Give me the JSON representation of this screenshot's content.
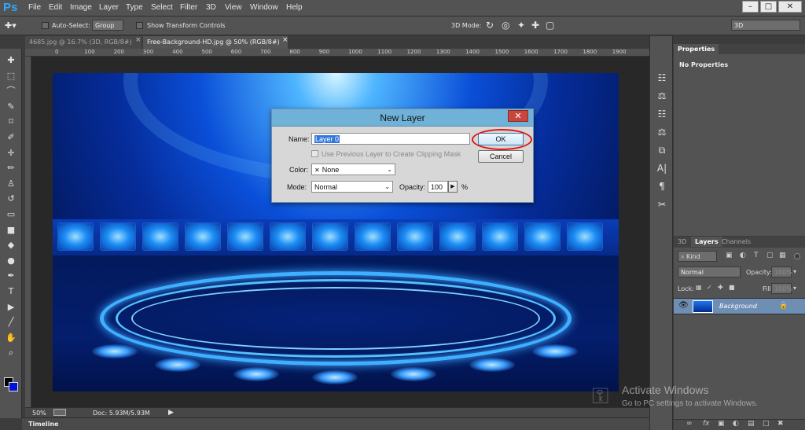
{
  "app": {
    "logo": "Ps"
  },
  "menu": [
    "File",
    "Edit",
    "Image",
    "Layer",
    "Type",
    "Select",
    "Filter",
    "3D",
    "View",
    "Window",
    "Help"
  ],
  "window_controls": {
    "minimize": "–",
    "restore": "□",
    "close": "✕"
  },
  "options_bar": {
    "auto_select_label": "Auto-Select:",
    "auto_select_value": "Group",
    "show_transform_label": "Show Transform Controls",
    "mode_label": "3D Mode:",
    "workspace_value": "3D"
  },
  "document_tabs": [
    {
      "label": "4685.jpg @ 16.7% (3D, RGB/8#)",
      "close": "×",
      "active": false
    },
    {
      "label": "Free-Background-HD.jpg @ 50% (RGB/8#)",
      "close": "×",
      "active": true
    }
  ],
  "ruler_numbers": [
    "0",
    "100",
    "200",
    "300",
    "400",
    "500",
    "600",
    "700",
    "800",
    "900",
    "1000",
    "1100",
    "1200",
    "1300",
    "1400",
    "1500",
    "1600",
    "1700",
    "1800",
    "1900"
  ],
  "tools": [
    {
      "icon": "move-tool-icon",
      "glyph": "✚"
    },
    {
      "icon": "marquee-tool-icon",
      "glyph": "⬚"
    },
    {
      "icon": "lasso-tool-icon",
      "glyph": "⌒"
    },
    {
      "icon": "quick-select-tool-icon",
      "glyph": "✎"
    },
    {
      "icon": "crop-tool-icon",
      "glyph": "⌑"
    },
    {
      "icon": "eyedropper-tool-icon",
      "glyph": "✐"
    },
    {
      "icon": "healing-brush-tool-icon",
      "glyph": "✛"
    },
    {
      "icon": "brush-tool-icon",
      "glyph": "✏"
    },
    {
      "icon": "clone-stamp-tool-icon",
      "glyph": "♙"
    },
    {
      "icon": "history-brush-tool-icon",
      "glyph": "↺"
    },
    {
      "icon": "eraser-tool-icon",
      "glyph": "▭"
    },
    {
      "icon": "gradient-tool-icon",
      "glyph": "■"
    },
    {
      "icon": "blur-tool-icon",
      "glyph": "◆"
    },
    {
      "icon": "dodge-tool-icon",
      "glyph": "●"
    },
    {
      "icon": "pen-tool-icon",
      "glyph": "✒"
    },
    {
      "icon": "type-tool-icon",
      "glyph": "T"
    },
    {
      "icon": "path-select-tool-icon",
      "glyph": "▶"
    },
    {
      "icon": "line-tool-icon",
      "glyph": "╱"
    },
    {
      "icon": "hand-tool-icon",
      "glyph": "✋"
    },
    {
      "icon": "zoom-tool-icon",
      "glyph": "⌕"
    }
  ],
  "status": {
    "zoom": "50%",
    "doc": "Doc: 5.93M/5.93M"
  },
  "timeline": {
    "label": "Timeline"
  },
  "side_icons": [
    "☷",
    "⚖",
    "☷",
    "⚖",
    "⧉",
    "A|",
    "¶",
    "✂"
  ],
  "properties": {
    "tab": "Properties",
    "content": "No Properties"
  },
  "layers_panel": {
    "tabs": [
      "3D",
      "Layers",
      "Channels"
    ],
    "filter_label": "Kind",
    "blend_mode": "Normal",
    "opacity_label": "Opacity:",
    "opacity_value": "100%",
    "lock_label": "Lock:",
    "fill_label": "Fill:",
    "fill_value": "100%",
    "layers": [
      {
        "name": "Background",
        "locked": true,
        "visible": true
      }
    ],
    "bottom_buttons": [
      "∞",
      "fx",
      "▣",
      "◐",
      "▤",
      "□",
      "✖"
    ]
  },
  "dialog": {
    "title": "New Layer",
    "close": "✕",
    "name_label": "Name:",
    "name_value": "Layer 0",
    "clipping_label": "Use Previous Layer to Create Clipping Mask",
    "color_label": "Color:",
    "color_value": "None",
    "color_marker": "✕",
    "mode_label": "Mode:",
    "mode_value": "Normal",
    "opacity_label": "Opacity:",
    "opacity_value": "100",
    "opacity_unit": "%",
    "ok": "OK",
    "cancel": "Cancel"
  },
  "watermark": {
    "title": "Activate Windows",
    "subtitle": "Go to PC settings to activate Windows."
  },
  "colors": {
    "accent": "#31a8ff",
    "highlight_ring": "#e01616",
    "dialog_title": "#6fb1d7",
    "close_red": "#c9463d"
  }
}
